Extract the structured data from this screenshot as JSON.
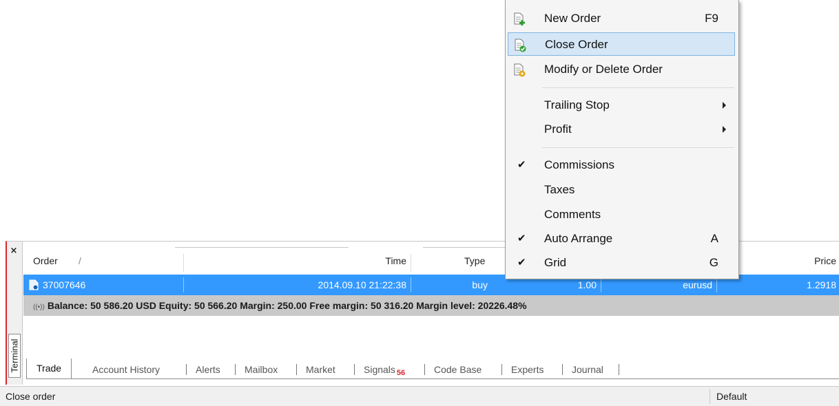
{
  "context_menu": {
    "items": [
      {
        "label": "New Order",
        "shortcut": "F9",
        "icon": "new-order-icon"
      },
      {
        "label": "Close Order",
        "icon": "close-order-icon",
        "highlighted": true
      },
      {
        "label": "Modify or Delete Order",
        "icon": "modify-order-icon"
      },
      {
        "label": "Trailing Stop",
        "submenu": true
      },
      {
        "label": "Profit",
        "submenu": true
      },
      {
        "label": "Commissions",
        "checked": true
      },
      {
        "label": "Taxes",
        "checked": false
      },
      {
        "label": "Comments",
        "checked": false
      },
      {
        "label": "Auto Arrange",
        "shortcut": "A",
        "checked": true
      },
      {
        "label": "Grid",
        "shortcut": "G",
        "checked": true
      }
    ]
  },
  "terminal": {
    "side_label": "Terminal",
    "close_icon": "close-icon",
    "columns": [
      "Order",
      "/",
      "Time",
      "Type",
      "Price"
    ],
    "rows": [
      {
        "order": "37007646",
        "time": "2014.09.10 21:22:38",
        "type": "buy",
        "size": "1.00",
        "symbol": "eurusd",
        "price": "1.2918"
      }
    ],
    "balance_text": "Balance: 50 586.20 USD  Equity: 50 566.20  Margin: 250.00  Free margin: 50 316.20  Margin level: 20226.48%",
    "tabs": [
      "Trade",
      "Account History",
      "Alerts",
      "Mailbox",
      "Market",
      "Signals",
      "Code Base",
      "Experts",
      "Journal"
    ],
    "active_tab": "Trade",
    "signals_count": "56"
  },
  "statusbar": {
    "text": "Close order",
    "profile": "Default"
  },
  "colors": {
    "selection": "#3399ff",
    "menu_highlight": "#d5e7f7",
    "terminal_border": "#d9272e",
    "signals_badge": "#d9272e"
  }
}
